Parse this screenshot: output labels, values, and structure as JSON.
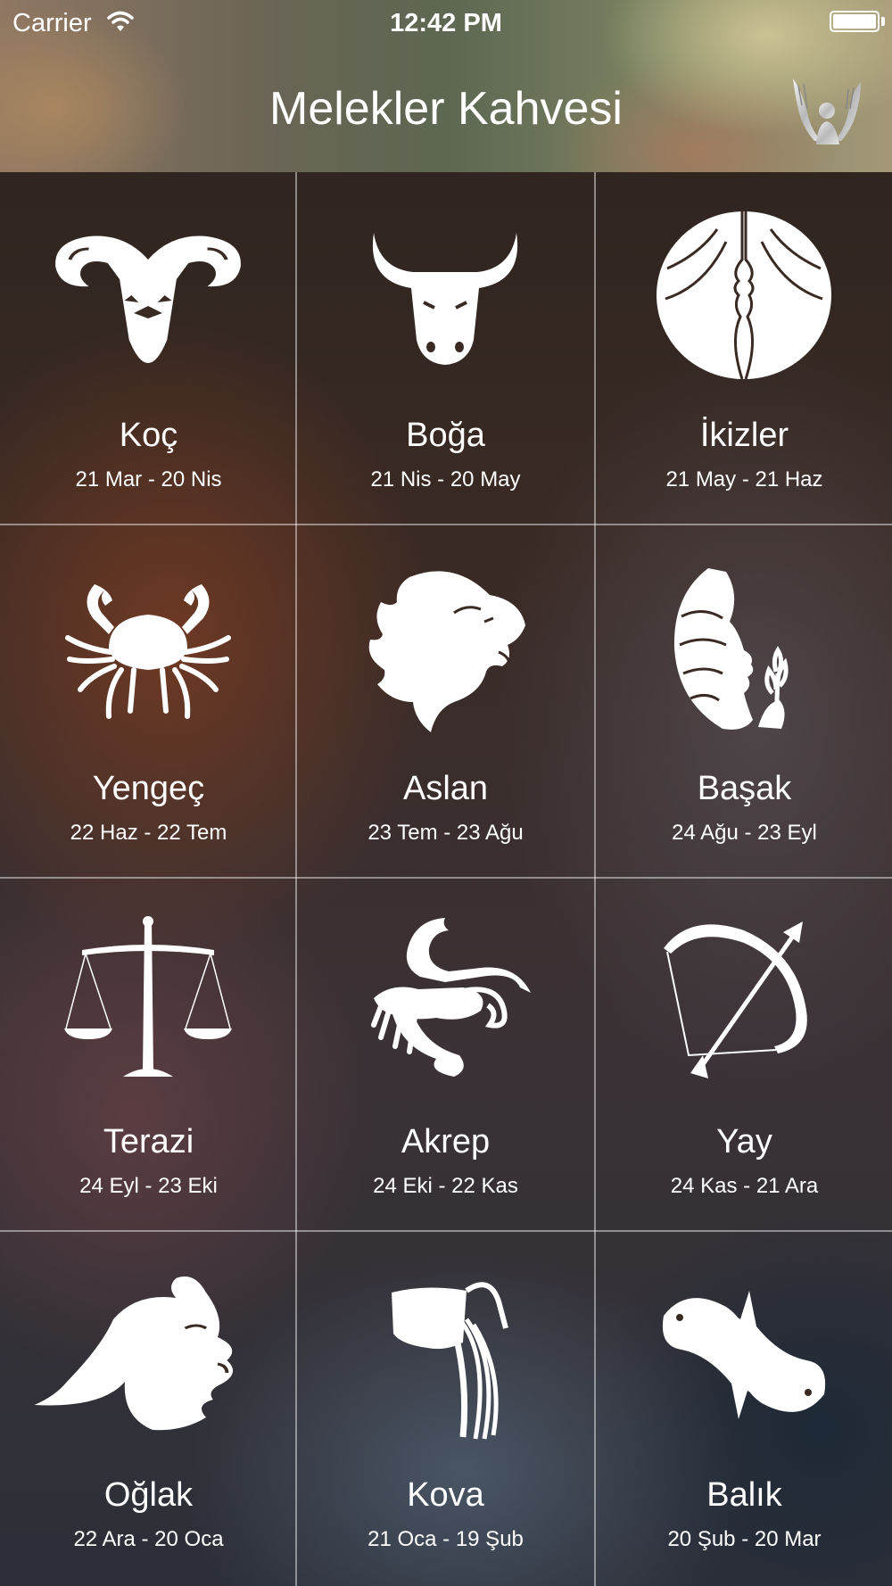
{
  "status_bar": {
    "carrier": "Carrier",
    "time": "12:42 PM"
  },
  "header": {
    "title": "Melekler Kahvesi"
  },
  "signs": [
    {
      "name": "Koç",
      "dates": "21 Mar - 20 Nis",
      "icon": "ram-icon"
    },
    {
      "name": "Boğa",
      "dates": "21 Nis - 20 May",
      "icon": "bull-icon"
    },
    {
      "name": "İkizler",
      "dates": "21 May - 21 Haz",
      "icon": "twins-icon"
    },
    {
      "name": "Yengeç",
      "dates": "22 Haz - 22 Tem",
      "icon": "crab-icon"
    },
    {
      "name": "Aslan",
      "dates": "23 Tem - 23 Ağu",
      "icon": "lion-icon"
    },
    {
      "name": "Başak",
      "dates": "24 Ağu - 23 Eyl",
      "icon": "maiden-icon"
    },
    {
      "name": "Terazi",
      "dates": "24 Eyl - 23 Eki",
      "icon": "scales-icon"
    },
    {
      "name": "Akrep",
      "dates": "24 Eki - 22 Kas",
      "icon": "scorpion-icon"
    },
    {
      "name": "Yay",
      "dates": "24 Kas - 21 Ara",
      "icon": "bow-arrow-icon"
    },
    {
      "name": "Oğlak",
      "dates": "22 Ara - 20 Oca",
      "icon": "goat-icon"
    },
    {
      "name": "Kova",
      "dates": "21 Oca - 19 Şub",
      "icon": "water-jug-icon"
    },
    {
      "name": "Balık",
      "dates": "20 Şub - 20 Mar",
      "icon": "fish-icon"
    }
  ]
}
